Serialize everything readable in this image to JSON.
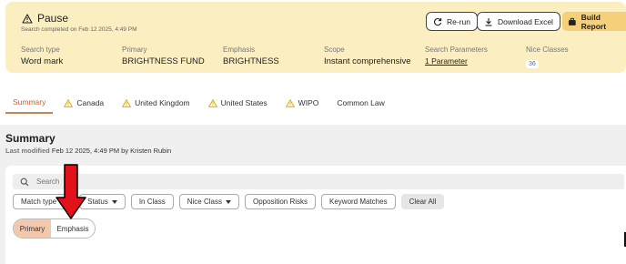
{
  "banner": {
    "status_title": "Pause",
    "status_icon": "warning-triangle-icon",
    "completed_text": "Search completed on Feb 12 2025, 4:49 PM",
    "fields": [
      {
        "label": "Search type",
        "value": "Word mark"
      },
      {
        "label": "Primary",
        "value": "BRIGHTNESS FUND"
      },
      {
        "label": "Emphasis",
        "value": "BRIGHTNESS"
      },
      {
        "label": "Scope",
        "value": "Instant comprehensive"
      },
      {
        "label": "Search Parameters",
        "value": "1 Parameter"
      },
      {
        "label": "Nice Classes",
        "value": "36"
      }
    ],
    "buttons": {
      "rerun": "Re-run",
      "download": "Download Excel",
      "build": "Build Report"
    },
    "bg_color": "#fbefc2"
  },
  "tabs": [
    {
      "label": "Summary",
      "warning": false,
      "active": true
    },
    {
      "label": "Canada",
      "warning": true,
      "active": false
    },
    {
      "label": "United Kingdom",
      "warning": true,
      "active": false
    },
    {
      "label": "United States",
      "warning": true,
      "active": false
    },
    {
      "label": "WIPO",
      "warning": true,
      "active": false
    },
    {
      "label": "Common Law",
      "warning": false,
      "active": false
    }
  ],
  "summary": {
    "title": "Summary",
    "last_modified_label": "Last modified",
    "last_modified_value": "Feb 12 2025, 4:49 PM by Kristen Rubin",
    "search_placeholder": "Search",
    "filters": {
      "match_type": "Match type",
      "status": "Status",
      "in_class": "In Class",
      "nice_class": "Nice Class",
      "opposition_risks": "Opposition Risks",
      "keyword_matches": "Keyword Matches",
      "clear_all": "Clear All"
    },
    "toggle": {
      "primary": "Primary",
      "emphasis": "Emphasis",
      "selected": "Primary"
    }
  },
  "colors": {
    "accent": "#c98454",
    "warning": "#e0a800",
    "annotation_arrow": "#e3111a"
  }
}
